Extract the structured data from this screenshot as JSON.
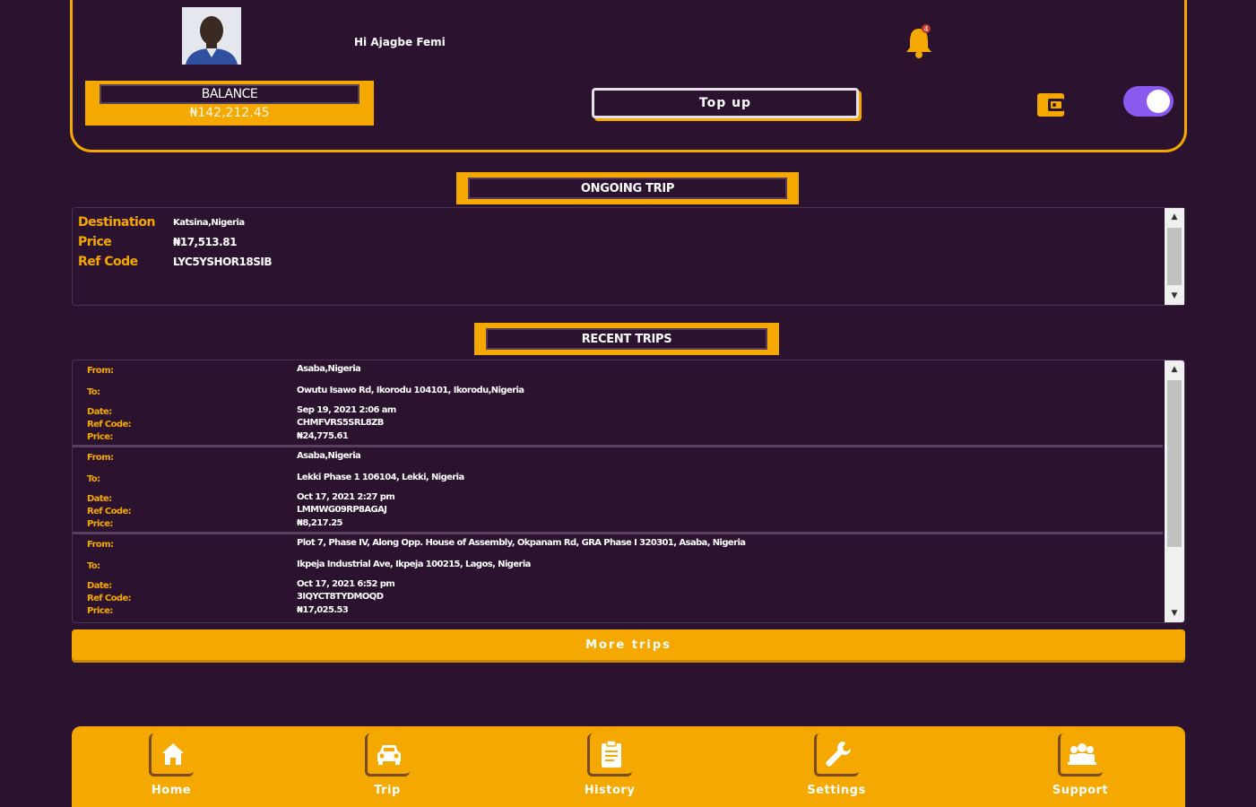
{
  "header": {
    "greeting": "Hi Ajagbe Femi",
    "balance_label": "BALANCE",
    "balance_value": "₦142,212.45",
    "topup_label": "Top up",
    "notification_count": "4"
  },
  "ongoing": {
    "title": "ONGOING TRIP",
    "destination_label": "Destination",
    "destination_value": "Katsina,Nigeria",
    "price_label": "Price",
    "price_value": "₦17,513.81",
    "ref_label": "Ref Code",
    "ref_value": "LYC5YSHOR18SIB"
  },
  "recent": {
    "title": "RECENT TRIPS",
    "labels": {
      "from": "From:",
      "to": "To:",
      "date": "Date:",
      "ref": "Ref Code:",
      "price": "Price:"
    },
    "trips": [
      {
        "from": "Asaba,Nigeria",
        "to": "Owutu Isawo Rd, Ikorodu 104101, Ikorodu,Nigeria",
        "date": "Sep 19, 2021 2:06 am",
        "ref": "CHMFVRS5SRL8ZB",
        "price": "₦24,775.61"
      },
      {
        "from": "Asaba,Nigeria",
        "to": "Lekki Phase 1 106104, Lekki, Nigeria",
        "date": "Oct 17, 2021 2:27 pm",
        "ref": "LMMWG09RP8AGAJ",
        "price": "₦8,217.25"
      },
      {
        "from": "Plot 7, Phase IV, Along Opp. House of Assembly, Okpanam Rd, GRA Phase I 320301, Asaba, Nigeria",
        "to": "Ikpeja Industrial Ave, Ikpeja 100215, Lagos, Nigeria",
        "date": "Oct 17, 2021 6:52 pm",
        "ref": "3IQYCT8TYDMOQD",
        "price": "₦17,025.53"
      }
    ]
  },
  "more_trips_label": "More trips",
  "nav": [
    {
      "label": "Home",
      "icon": "home-icon"
    },
    {
      "label": "Trip",
      "icon": "car-icon"
    },
    {
      "label": "History",
      "icon": "clipboard-icon"
    },
    {
      "label": "Settings",
      "icon": "wrench-icon"
    },
    {
      "label": "Support",
      "icon": "people-icon"
    }
  ],
  "colors": {
    "background": "#2b1330",
    "accent": "#f5a800",
    "toggle": "#8a5af0"
  }
}
